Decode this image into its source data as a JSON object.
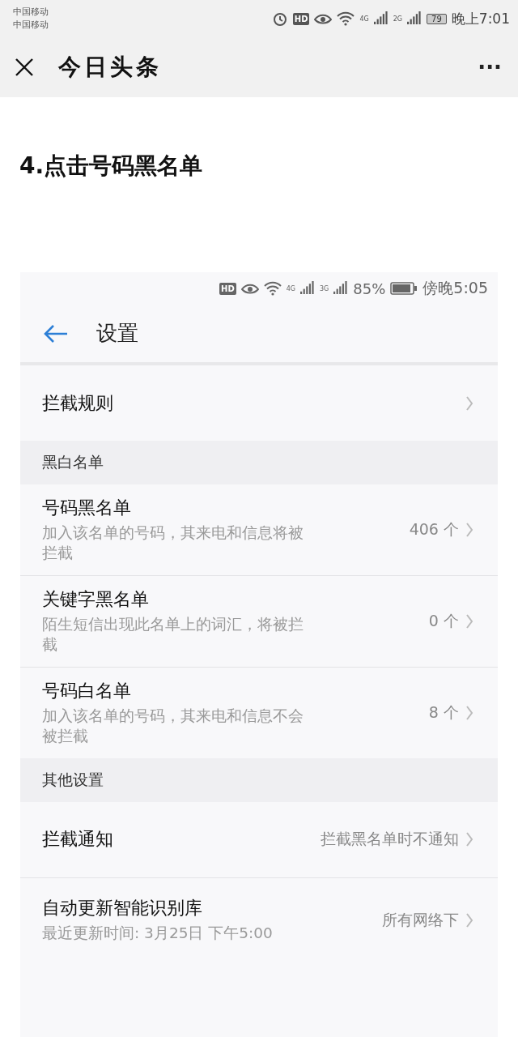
{
  "status_bar": {
    "carriers": [
      "中国移动",
      "中国移动"
    ],
    "hd": "HD",
    "net_1": "4G",
    "net_2": "2G",
    "battery": "79",
    "time": "晚上7:01"
  },
  "app_bar": {
    "title": "今日头条",
    "more": "···"
  },
  "article": {
    "heading": "4.点击号码黑名单"
  },
  "screenshot": {
    "status_bar": {
      "hd": "HD",
      "net_1": "4G",
      "net_2": "3G",
      "battery": "85%",
      "time": "傍晚5:05"
    },
    "title": "设置",
    "groups": [
      {
        "rows": [
          {
            "title": "拦截规则"
          }
        ]
      },
      {
        "header": "黑白名单",
        "rows": [
          {
            "title": "号码黑名单",
            "subtitle": "加入该名单的号码，其来电和信息将被拦截",
            "value": "406 个"
          },
          {
            "title": "关键字黑名单",
            "subtitle": "陌生短信出现此名单上的词汇，将被拦截",
            "value": "0 个"
          },
          {
            "title": "号码白名单",
            "subtitle": "加入该名单的号码，其来电和信息不会被拦截",
            "value": "8 个"
          }
        ]
      },
      {
        "header": "其他设置",
        "rows": [
          {
            "title": "拦截通知",
            "value": "拦截黑名单时不通知"
          },
          {
            "title": "自动更新智能识别库",
            "subtitle": "最近更新时间: 3月25日 下午5:00",
            "value": "所有网络下"
          }
        ]
      }
    ]
  }
}
